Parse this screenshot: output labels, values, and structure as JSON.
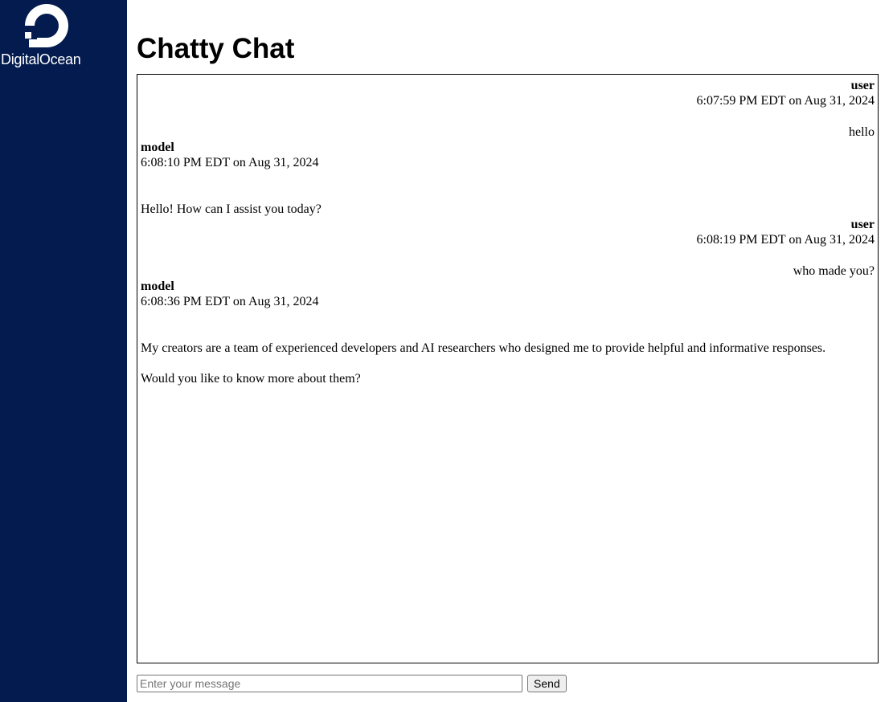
{
  "sidebar": {
    "brand": {
      "name": "DigitalOcean",
      "icon": "digitalocean-logo-icon",
      "background_color": "#031b4e",
      "text_color": "#ffffff"
    }
  },
  "header": {
    "title": "Chatty Chat"
  },
  "chat": {
    "messages": [
      {
        "role": "user",
        "timestamp": "6:07:59 PM EDT on Aug 31, 2024",
        "paragraphs": [
          "hello"
        ]
      },
      {
        "role": "model",
        "timestamp": "6:08:10 PM EDT on Aug 31, 2024",
        "paragraphs": [
          "Hello! How can I assist you today?"
        ]
      },
      {
        "role": "user",
        "timestamp": "6:08:19 PM EDT on Aug 31, 2024",
        "paragraphs": [
          "who made you?"
        ]
      },
      {
        "role": "model",
        "timestamp": "6:08:36 PM EDT on Aug 31, 2024",
        "paragraphs": [
          "My creators are a team of experienced developers and AI researchers who designed me to provide helpful and informative responses.",
          "Would you like to know more about them?"
        ]
      }
    ]
  },
  "composer": {
    "input_value": "",
    "input_placeholder": "Enter your message",
    "send_label": "Send"
  }
}
